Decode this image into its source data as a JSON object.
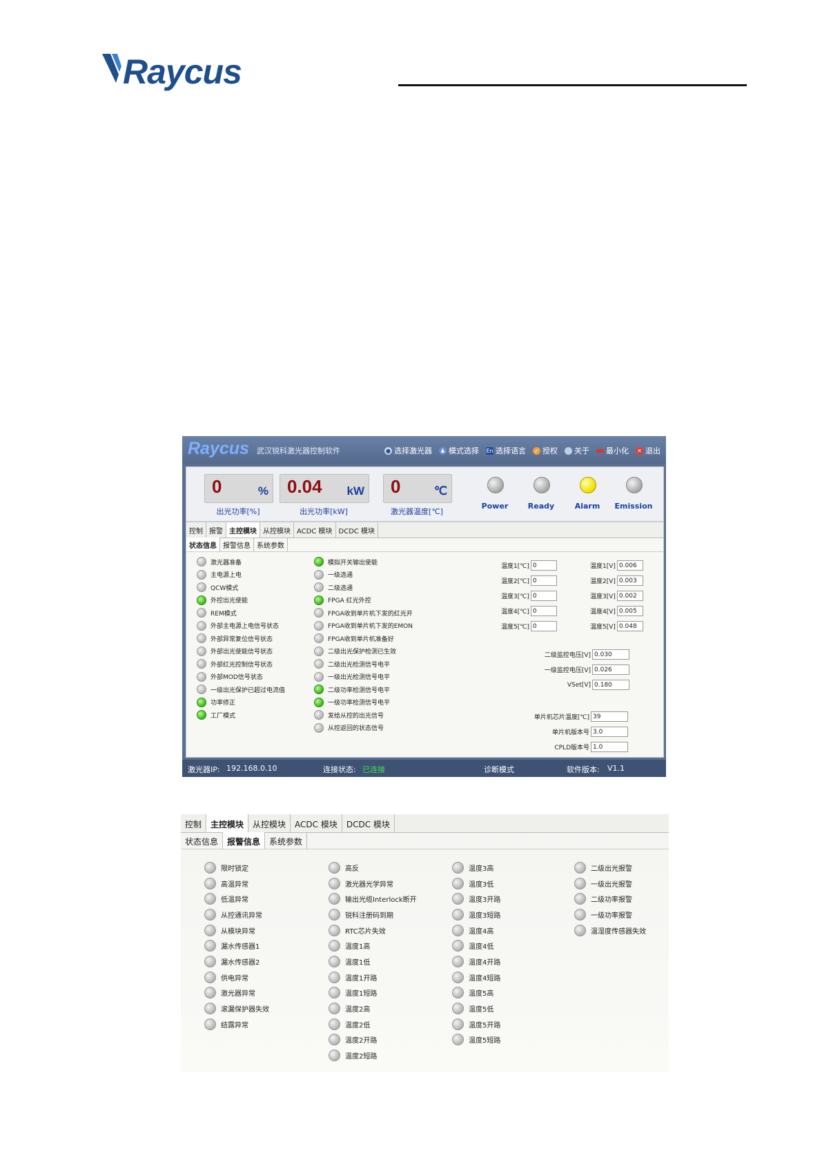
{
  "brand": {
    "name": "Raycus"
  },
  "app": {
    "brand": "Raycus",
    "subtitle": "武汉锐科激光器控制软件",
    "menu": [
      {
        "icon": "bulb-icon",
        "label": "选择激光器"
      },
      {
        "icon": "users-icon",
        "label": "模式选择"
      },
      {
        "icon": "language-icon",
        "label": "选择语言",
        "glyph": "En"
      },
      {
        "icon": "auth-icon",
        "label": "授权"
      },
      {
        "icon": "info-icon",
        "label": "关于"
      },
      {
        "icon": "minimize-icon",
        "label": "最小化"
      },
      {
        "icon": "exit-icon",
        "label": "退出"
      }
    ],
    "gauges": [
      {
        "value": "0",
        "unit": "%",
        "caption": "出光功率[%]"
      },
      {
        "value": "0.04",
        "unit": "kW",
        "caption": "出光功率[kW]"
      },
      {
        "value": "0",
        "unit": "℃",
        "caption": "激光器温度[℃]"
      }
    ],
    "indicators": [
      {
        "label": "Power",
        "state": "off"
      },
      {
        "label": "Ready",
        "state": "off"
      },
      {
        "label": "Alarm",
        "state": "yellow"
      },
      {
        "label": "Emission",
        "state": "off"
      }
    ],
    "tabs": [
      {
        "label": "控制",
        "active": false
      },
      {
        "label": "报警",
        "active": false
      },
      {
        "label": "主控模块",
        "active": true
      },
      {
        "label": "从控模块",
        "active": false
      },
      {
        "label": "ACDC 模块",
        "active": false
      },
      {
        "label": "DCDC 模块",
        "active": false
      }
    ],
    "subtabs": [
      {
        "label": "状态信息",
        "active": true
      },
      {
        "label": "报警信息",
        "active": false
      },
      {
        "label": "系统参数",
        "active": false
      }
    ],
    "status_col1": [
      {
        "label": "激光器准备",
        "on": false
      },
      {
        "label": "主电源上电",
        "on": false
      },
      {
        "label": "QCW模式",
        "on": false
      },
      {
        "label": "外控出光使能",
        "on": true
      },
      {
        "label": "REM模式",
        "on": false
      },
      {
        "label": "外部主电源上电信号状态",
        "on": false
      },
      {
        "label": "外部异常复位信号状态",
        "on": false
      },
      {
        "label": "外部出光使能信号状态",
        "on": false
      },
      {
        "label": "外部红光控制信号状态",
        "on": false
      },
      {
        "label": "外部MOD信号状态",
        "on": false
      },
      {
        "label": "一级出光保护已超过电流值",
        "on": false
      },
      {
        "label": "功率修正",
        "on": true
      },
      {
        "label": "工厂模式",
        "on": true
      }
    ],
    "status_col2": [
      {
        "label": "模拟开关输出使能",
        "on": true
      },
      {
        "label": "一级选通",
        "on": false
      },
      {
        "label": "二级选通",
        "on": false
      },
      {
        "label": "FPGA 红光外控",
        "on": true
      },
      {
        "label": "FPGA收到单片机下发的红光开",
        "on": false
      },
      {
        "label": "FPGA收到单片机下发的EMON",
        "on": false
      },
      {
        "label": "FPGA收到单片机准备好",
        "on": false
      },
      {
        "label": "二级出光保护检测已生效",
        "on": false
      },
      {
        "label": "二级出光检测信号电平",
        "on": false
      },
      {
        "label": "一级出光检测信号电平",
        "on": false
      },
      {
        "label": "二级功率检测信号电平",
        "on": true
      },
      {
        "label": "一级功率检测信号电平",
        "on": true
      },
      {
        "label": "发给从控的出光信号",
        "on": false
      },
      {
        "label": "从控返回的状态信号",
        "on": false
      }
    ],
    "temps_c": [
      {
        "label": "温度1[℃]",
        "value": "0"
      },
      {
        "label": "温度2[℃]",
        "value": "0"
      },
      {
        "label": "温度3[℃]",
        "value": "0"
      },
      {
        "label": "温度4[℃]",
        "value": "0"
      },
      {
        "label": "温度5[℃]",
        "value": "0"
      }
    ],
    "temps_v": [
      {
        "label": "温度1[V]",
        "value": "0.006"
      },
      {
        "label": "温度2[V]",
        "value": "0.003"
      },
      {
        "label": "温度3[V]",
        "value": "0.002"
      },
      {
        "label": "温度4[V]",
        "value": "0.005"
      },
      {
        "label": "温度5[V]",
        "value": "0.048"
      }
    ],
    "volts": [
      {
        "label": "二级监控电压[V]",
        "value": "0.030"
      },
      {
        "label": "一级监控电压[V]",
        "value": "0.026"
      },
      {
        "label": "VSet[V]",
        "value": "0.180"
      }
    ],
    "chip": [
      {
        "label": "单片机芯片温度[℃]",
        "value": "39"
      },
      {
        "label": "单片机版本号",
        "value": "3.0"
      },
      {
        "label": "CPLD版本号",
        "value": "1.0"
      }
    ],
    "statusbar": {
      "ip_label": "激光器IP:",
      "ip": "192.168.0.10",
      "conn_label": "连接状态:",
      "conn": "已连接",
      "mode": "诊断模式",
      "ver_label": "软件版本:",
      "ver": "V1.1"
    }
  },
  "app2": {
    "tabs": [
      {
        "label": "控制",
        "active": false
      },
      {
        "label": "主控模块",
        "active": true
      },
      {
        "label": "从控模块",
        "active": false
      },
      {
        "label": "ACDC 模块",
        "active": false
      },
      {
        "label": "DCDC 模块",
        "active": false
      }
    ],
    "subtabs": [
      {
        "label": "状态信息",
        "active": false
      },
      {
        "label": "报警信息",
        "active": true
      },
      {
        "label": "系统参数",
        "active": false
      }
    ],
    "col1": [
      "限时锁定",
      "高温异常",
      "低温异常",
      "从控通讯异常",
      "从模块异常",
      "漏水传感器1",
      "漏水传感器2",
      "供电异常",
      "激光器异常",
      "滚漏保护器失效",
      "结露异常"
    ],
    "col2": [
      "高反",
      "激光器光学异常",
      "输出光缆Interlock断开",
      "锐科注册码到期",
      "RTC芯片失效",
      "温度1高",
      "温度1低",
      "温度1开路",
      "温度1短路",
      "温度2高",
      "温度2低",
      "温度2开路",
      "温度2短路"
    ],
    "col3": [
      "温度3高",
      "温度3低",
      "温度3开路",
      "温度3短路",
      "温度4高",
      "温度4低",
      "温度4开路",
      "温度4短路",
      "温度5高",
      "温度5低",
      "温度5开路",
      "温度5短路"
    ],
    "col4": [
      "二级出光报警",
      "一级出光报警",
      "二级功率报警",
      "一级功率报警",
      "温湿度传感器失效"
    ]
  }
}
